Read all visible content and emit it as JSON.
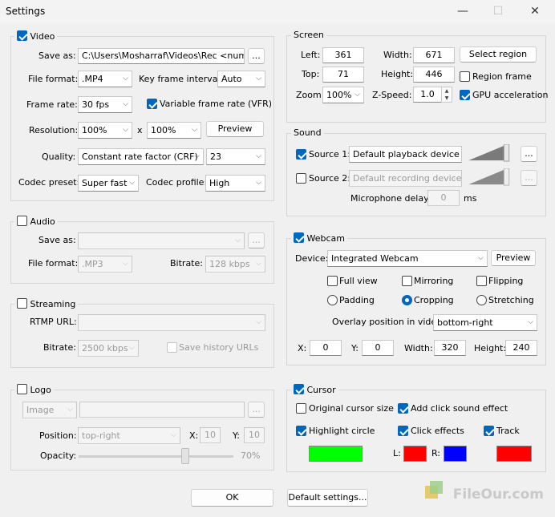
{
  "window": {
    "title": "Settings"
  },
  "video": {
    "group_label": "Video",
    "enabled": true,
    "save_as_label": "Save as:",
    "save_as_value": "C:\\Users\\Mosharraf\\Videos\\Rec <num",
    "browse_label": "...",
    "file_format_label": "File format:",
    "file_format_value": ".MP4",
    "key_frame_label": "Key frame interval:",
    "key_frame_value": "Auto",
    "frame_rate_label": "Frame rate:",
    "frame_rate_value": "30 fps",
    "vfr_label": "Variable frame rate (VFR)",
    "vfr_checked": true,
    "resolution_label": "Resolution:",
    "resolution_w": "100%",
    "resolution_x": "x",
    "resolution_h": "100%",
    "preview_label": "Preview",
    "quality_label": "Quality:",
    "quality_value": "Constant rate factor (CRF)",
    "quality_num": "23",
    "codec_preset_label": "Codec preset:",
    "codec_preset_value": "Super fast",
    "codec_profile_label": "Codec profile:",
    "codec_profile_value": "High"
  },
  "audio": {
    "group_label": "Audio",
    "enabled": false,
    "save_as_label": "Save as:",
    "save_as_value": "",
    "browse_label": "...",
    "file_format_label": "File format:",
    "file_format_value": ".MP3",
    "bitrate_label": "Bitrate:",
    "bitrate_value": "128 kbps"
  },
  "streaming": {
    "group_label": "Streaming",
    "enabled": false,
    "rtmp_label": "RTMP URL:",
    "rtmp_value": "",
    "bitrate_label": "Bitrate:",
    "bitrate_value": "2500 kbps",
    "save_history_label": "Save history URLs"
  },
  "logo": {
    "group_label": "Logo",
    "enabled": false,
    "type_value": "Image",
    "browse_label": "...",
    "position_label": "Position:",
    "position_value": "top-right",
    "x_label": "X:",
    "x_value": "10",
    "y_label": "Y:",
    "y_value": "10",
    "opacity_label": "Opacity:",
    "opacity_value": "70%",
    "opacity_level": 0.7
  },
  "screen": {
    "group_label": "Screen",
    "left_label": "Left:",
    "left_value": "361",
    "top_label": "Top:",
    "top_value": "71",
    "width_label": "Width:",
    "width_value": "671",
    "height_label": "Height:",
    "height_value": "446",
    "select_region_label": "Select region",
    "region_frame_label": "Region frame",
    "region_frame_checked": false,
    "zoom_label": "Zoom:",
    "zoom_value": "100%",
    "zspeed_label": "Z-Speed:",
    "zspeed_value": "1.0",
    "gpu_label": "GPU acceleration",
    "gpu_checked": true
  },
  "sound": {
    "group_label": "Sound",
    "source1_label": "Source 1:",
    "source1_checked": true,
    "source1_value": "Default playback device",
    "source2_label": "Source 2:",
    "source2_checked": false,
    "source2_value": "Default recording device",
    "more_label": "...",
    "mic_delay_label": "Microphone delay:",
    "mic_delay_value": "0",
    "mic_delay_unit": "ms"
  },
  "webcam": {
    "group_label": "Webcam",
    "enabled": true,
    "device_label": "Device:",
    "device_value": "Integrated Webcam",
    "preview_label": "Preview",
    "full_view_label": "Full view",
    "mirroring_label": "Mirroring",
    "flipping_label": "Flipping",
    "padding_label": "Padding",
    "cropping_label": "Cropping",
    "stretching_label": "Stretching",
    "overlay_label": "Overlay position in video:",
    "overlay_value": "bottom-right",
    "x_label": "X:",
    "x_value": "0",
    "y_label": "Y:",
    "y_value": "0",
    "width_label": "Width:",
    "width_value": "320",
    "height_label": "Height:",
    "height_value": "240"
  },
  "cursor": {
    "group_label": "Cursor",
    "enabled": true,
    "original_size_label": "Original cursor size",
    "click_sound_label": "Add click sound effect",
    "highlight_label": "Highlight circle",
    "click_effects_label": "Click effects",
    "track_label": "Track",
    "l_label": "L:",
    "r_label": "R:",
    "highlight_color": "#00ff00",
    "left_click_color": "#ff0000",
    "right_click_color": "#0000ff",
    "track_color": "#ff0000"
  },
  "footer": {
    "ok_label": "OK",
    "default_label": "Default settings..."
  },
  "watermark": {
    "text": "FileOur.com"
  }
}
